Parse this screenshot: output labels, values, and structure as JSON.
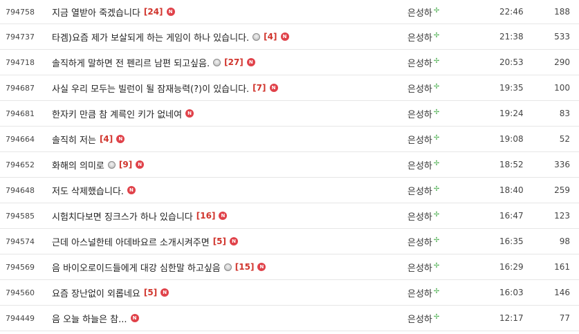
{
  "rows": [
    {
      "id": "794758",
      "title": "지금 열받아 죽겠습니다",
      "face": false,
      "comments": "[24]",
      "author": "은성하",
      "time": "22:46",
      "views": "188"
    },
    {
      "id": "794737",
      "title": "타겜)요즘 제가 보살되게 하는 게임이 하나 있습니다.",
      "face": true,
      "comments": "[4]",
      "author": "은성하",
      "time": "21:38",
      "views": "533"
    },
    {
      "id": "794718",
      "title": "솔직하게 말하면 전 펜리르 남편 되고싶음.",
      "face": true,
      "comments": "[27]",
      "author": "은성하",
      "time": "20:53",
      "views": "290"
    },
    {
      "id": "794687",
      "title": "사실 우리 모두는 빌런이 될 잠재능력(?)이 있습니다.",
      "face": false,
      "comments": "[7]",
      "author": "은성하",
      "time": "19:35",
      "views": "100"
    },
    {
      "id": "794681",
      "title": "한자키 만큼 참 계륵인 키가 없네여",
      "face": false,
      "comments": "",
      "author": "은성하",
      "time": "19:24",
      "views": "83"
    },
    {
      "id": "794664",
      "title": "솔직히 저는",
      "face": false,
      "comments": "[4]",
      "author": "은성하",
      "time": "19:08",
      "views": "52"
    },
    {
      "id": "794652",
      "title": "화해의 의미로",
      "face": true,
      "comments": "[9]",
      "author": "은성하",
      "time": "18:52",
      "views": "336"
    },
    {
      "id": "794648",
      "title": "저도 삭제했습니다.",
      "face": false,
      "comments": "",
      "author": "은성하",
      "time": "18:40",
      "views": "259"
    },
    {
      "id": "794585",
      "title": "시험치다보면 징크스가 하나 있습니다",
      "face": false,
      "comments": "[16]",
      "author": "은성하",
      "time": "16:47",
      "views": "123"
    },
    {
      "id": "794574",
      "title": "근데 아스널한테 아데바요르 소개시켜주면",
      "face": false,
      "comments": "[5]",
      "author": "은성하",
      "time": "16:35",
      "views": "98"
    },
    {
      "id": "794569",
      "title": "음 바이오로이드들에게 대강 심한말 하고싶음",
      "face": true,
      "comments": "[15]",
      "author": "은성하",
      "time": "16:29",
      "views": "161"
    },
    {
      "id": "794560",
      "title": "요즘 장난없이 외롭네요",
      "face": false,
      "comments": "[5]",
      "author": "은성하",
      "time": "16:03",
      "views": "146"
    },
    {
      "id": "794449",
      "title": "음 오늘 하늘은 참...",
      "face": false,
      "comments": "",
      "author": "은성하",
      "time": "12:17",
      "views": "77"
    }
  ],
  "icons": {
    "new_badge": "N",
    "leaf": "✢"
  },
  "colors": {
    "comment_count": "#d0342c",
    "new_badge": "#e0424a",
    "leaf": "#4caf50",
    "divider": "#e6e6e6"
  }
}
